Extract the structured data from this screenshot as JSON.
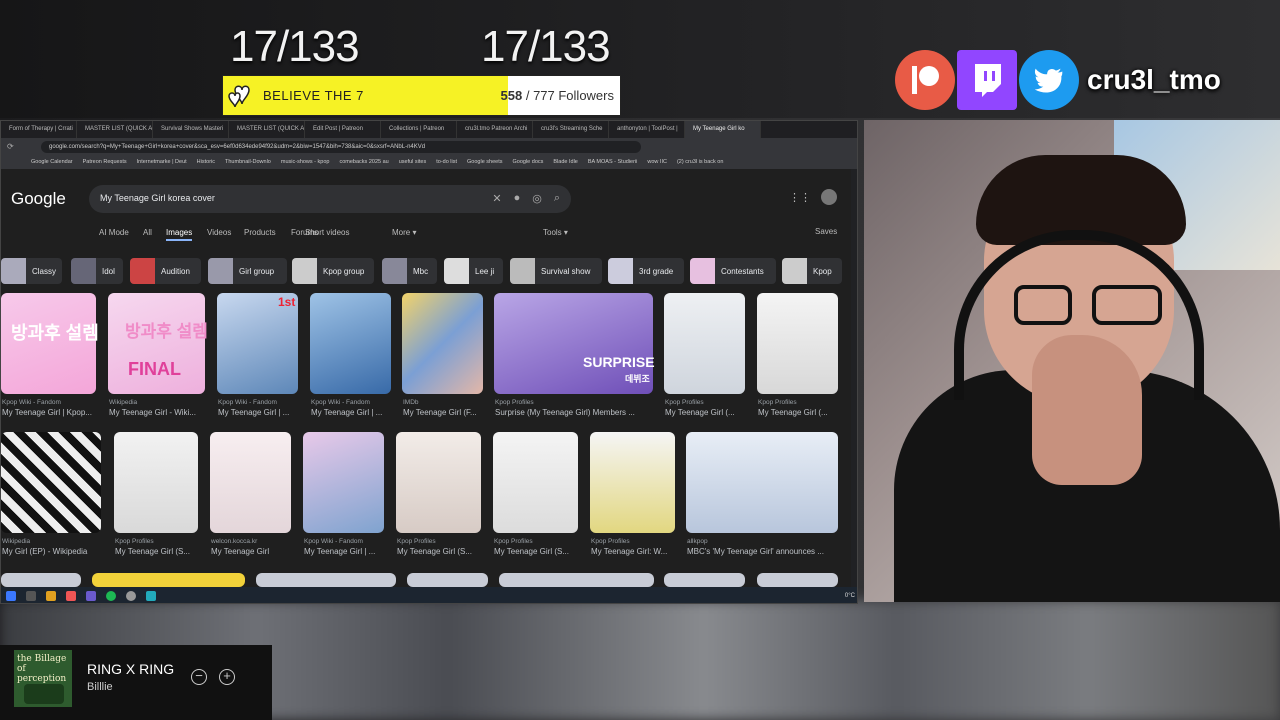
{
  "overlay": {
    "counter_left": "17/133",
    "counter_right": "17/133",
    "goal": {
      "label": "BELIEVE THE 7",
      "current": "558",
      "total": "/ 777 Followers",
      "progress": 0.718
    },
    "social_handle": "cru3l_tmo",
    "social_icons": [
      "patreon-icon",
      "twitch-icon",
      "twitter-icon"
    ]
  },
  "browser": {
    "tabs": [
      "Form of Therapy | Crrati",
      "MASTER LIST (QUICK AI",
      "Survival Shows Masteri",
      "MASTER LIST (QUICK AI",
      "Edit Post | Patreon",
      "Collections | Patreon",
      "cru3l.tmo Patreon Archi",
      "cru3l's Streaming Sche",
      "anthonyton | ToolPost |",
      "My Teenage Girl ko"
    ],
    "url": "google.com/search?q=My+Teenage+Girl+korea+cover&sca_esv=6ef0d634ede94f92&udm=2&biw=1547&bih=738&aic=0&sxsrf=ANbL-n4KVd",
    "bookmarks": [
      "Google Calendar",
      "Patreon Requests",
      "Internetmarke | Deut",
      "Historic",
      "Thumbnail-Downlo",
      "music-shows - kpop",
      "comebacks 2025 au",
      "useful sites",
      "to-do list",
      "Google sheets",
      "Google docs",
      "Blade Idle",
      "BA MOAS - Studierii",
      "wow IIC",
      "(2) cru3l is back on"
    ]
  },
  "google": {
    "logo": "Google",
    "query": "My Teenage Girl korea cover",
    "filters": [
      "AI Mode",
      "All",
      "Images",
      "Videos",
      "Products",
      "Forums",
      "Short videos",
      "More ▾"
    ],
    "active_filter": "Images",
    "tools": "Tools ▾",
    "saves": "Saves",
    "chips": [
      "Classy",
      "Idol",
      "Audition",
      "Girl group",
      "Kpop group",
      "Mbc",
      "Lee ji",
      "Survival show",
      "3rd grade",
      "Contestants",
      "Kpop"
    ],
    "row1": [
      {
        "src": "Kpop Wiki - Fandom",
        "title": "My Teenage Girl | Kpop..."
      },
      {
        "src": "Wikipedia",
        "title": "My Teenage Girl - Wiki..."
      },
      {
        "src": "Kpop Wiki - Fandom",
        "title": "My Teenage Girl | ..."
      },
      {
        "src": "Kpop Wiki - Fandom",
        "title": "My Teenage Girl | ..."
      },
      {
        "src": "IMDb",
        "title": "My Teenage Girl (F..."
      },
      {
        "src": "Kpop Profiles",
        "title": "Surprise (My Teenage Girl) Members ..."
      },
      {
        "src": "Kpop Profiles",
        "title": "My Teenage Girl (..."
      },
      {
        "src": "Kpop Profiles",
        "title": "My Teenage Girl (..."
      }
    ],
    "row1_texts": {
      "a": "방과후 설렘",
      "b": "방과후 설렘",
      "b2": "FINAL",
      "c": "1st",
      "f": "SURPRISE",
      "f2": "데뷔조"
    },
    "row2": [
      {
        "src": "Wikipedia",
        "title": "My Girl (EP) - Wikipedia"
      },
      {
        "src": "Kpop Profiles",
        "title": "My Teenage Girl (S..."
      },
      {
        "src": "welcon.kocca.kr",
        "title": "My Teenage Girl"
      },
      {
        "src": "Kpop Wiki - Fandom",
        "title": "My Teenage Girl | ..."
      },
      {
        "src": "Kpop Profiles",
        "title": "My Teenage Girl (S..."
      },
      {
        "src": "Kpop Profiles",
        "title": "My Teenage Girl (S..."
      },
      {
        "src": "Kpop Profiles",
        "title": "My Teenage Girl: W..."
      },
      {
        "src": "allkpop",
        "title": "MBC's 'My Teenage Girl' announces ..."
      }
    ]
  },
  "taskbar": {
    "temp": "0°C"
  },
  "now_playing": {
    "title": "RING X RING",
    "artist": "Billlie",
    "art_text": "the Billage of perception"
  },
  "colors": {
    "goal_yellow": "#f6f225",
    "patreon": "#e85b46",
    "twitch": "#9146ff",
    "twitter": "#1d9bf0"
  }
}
